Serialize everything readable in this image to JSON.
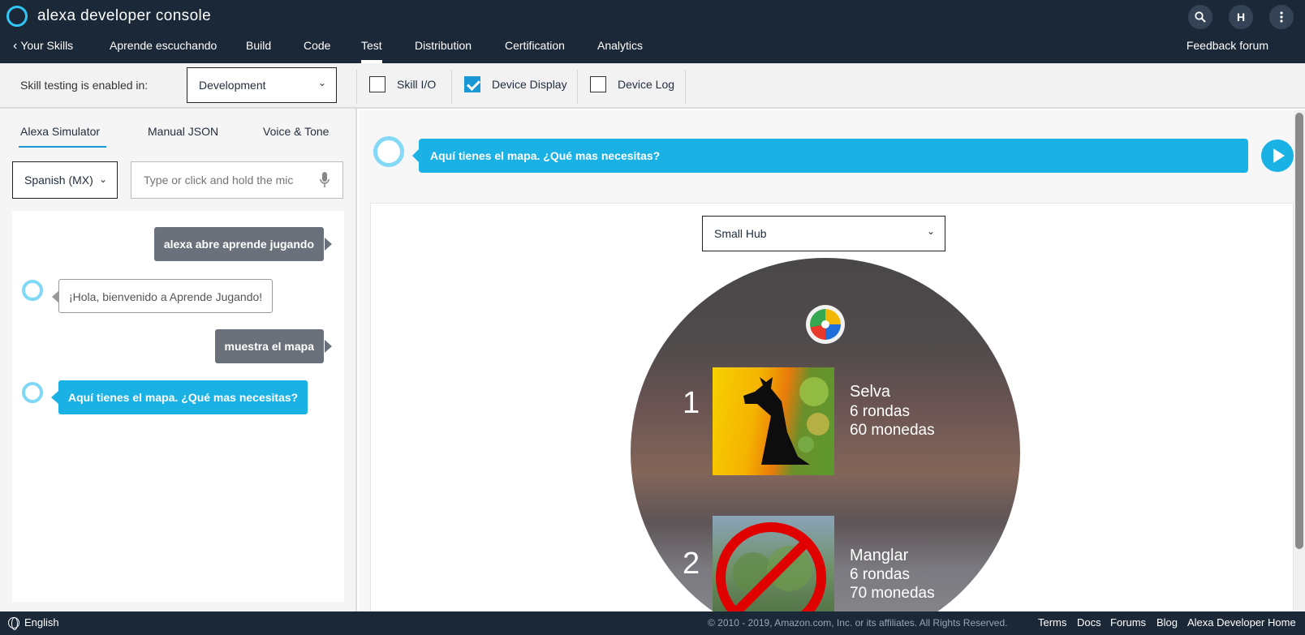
{
  "app": {
    "title": "alexa developer console"
  },
  "header": {
    "search_icon": "search-icon",
    "avatar_initial": "H",
    "more_icon": "vertical-dots-icon"
  },
  "nav": {
    "back_label": "Your Skills",
    "skill_name": "Aprende escuchando",
    "items": [
      "Build",
      "Code",
      "Test",
      "Distribution",
      "Certification",
      "Analytics"
    ],
    "active": "Test",
    "feedback": "Feedback forum"
  },
  "settings": {
    "label": "Skill testing is enabled in:",
    "stage": "Development",
    "checks": [
      {
        "label": "Skill I/O",
        "checked": false
      },
      {
        "label": "Device Display",
        "checked": true
      },
      {
        "label": "Device Log",
        "checked": false
      }
    ]
  },
  "left": {
    "tabs": [
      "Alexa Simulator",
      "Manual JSON",
      "Voice & Tone"
    ],
    "active_tab": "Alexa Simulator",
    "language": "Spanish (MX)",
    "input_placeholder": "Type or click and hold the mic",
    "messages": [
      {
        "from": "user",
        "text": "alexa abre aprende jugando"
      },
      {
        "from": "alexa",
        "text": "¡Hola, bienvenido a Aprende Jugando!"
      },
      {
        "from": "user",
        "text": "muestra el mapa"
      },
      {
        "from": "alexa",
        "text": "Aquí tienes el mapa. ¿Qué mas necesitas?"
      }
    ]
  },
  "right": {
    "response": "Aquí tienes el mapa. ¿Qué mas necesitas?",
    "device": "Small Hub",
    "items": [
      {
        "num": "1",
        "title": "Selva",
        "rounds": "6 rondas",
        "coins": "60 monedas",
        "locked": false
      },
      {
        "num": "2",
        "title": "Manglar",
        "rounds": "6 rondas",
        "coins": "70 monedas",
        "locked": true
      }
    ]
  },
  "footer": {
    "language": "English",
    "copyright": "© 2010 - 2019, Amazon.com, Inc. or its affiliates. All Rights Reserved.",
    "links": [
      "Terms",
      "Docs",
      "Forums",
      "Blog",
      "Alexa Developer Home"
    ]
  },
  "colors": {
    "topbar": "#1b2838",
    "accent": "#1ab1e5",
    "alexa_ring": "#31c6f5",
    "user_bubble": "#6b717a"
  }
}
